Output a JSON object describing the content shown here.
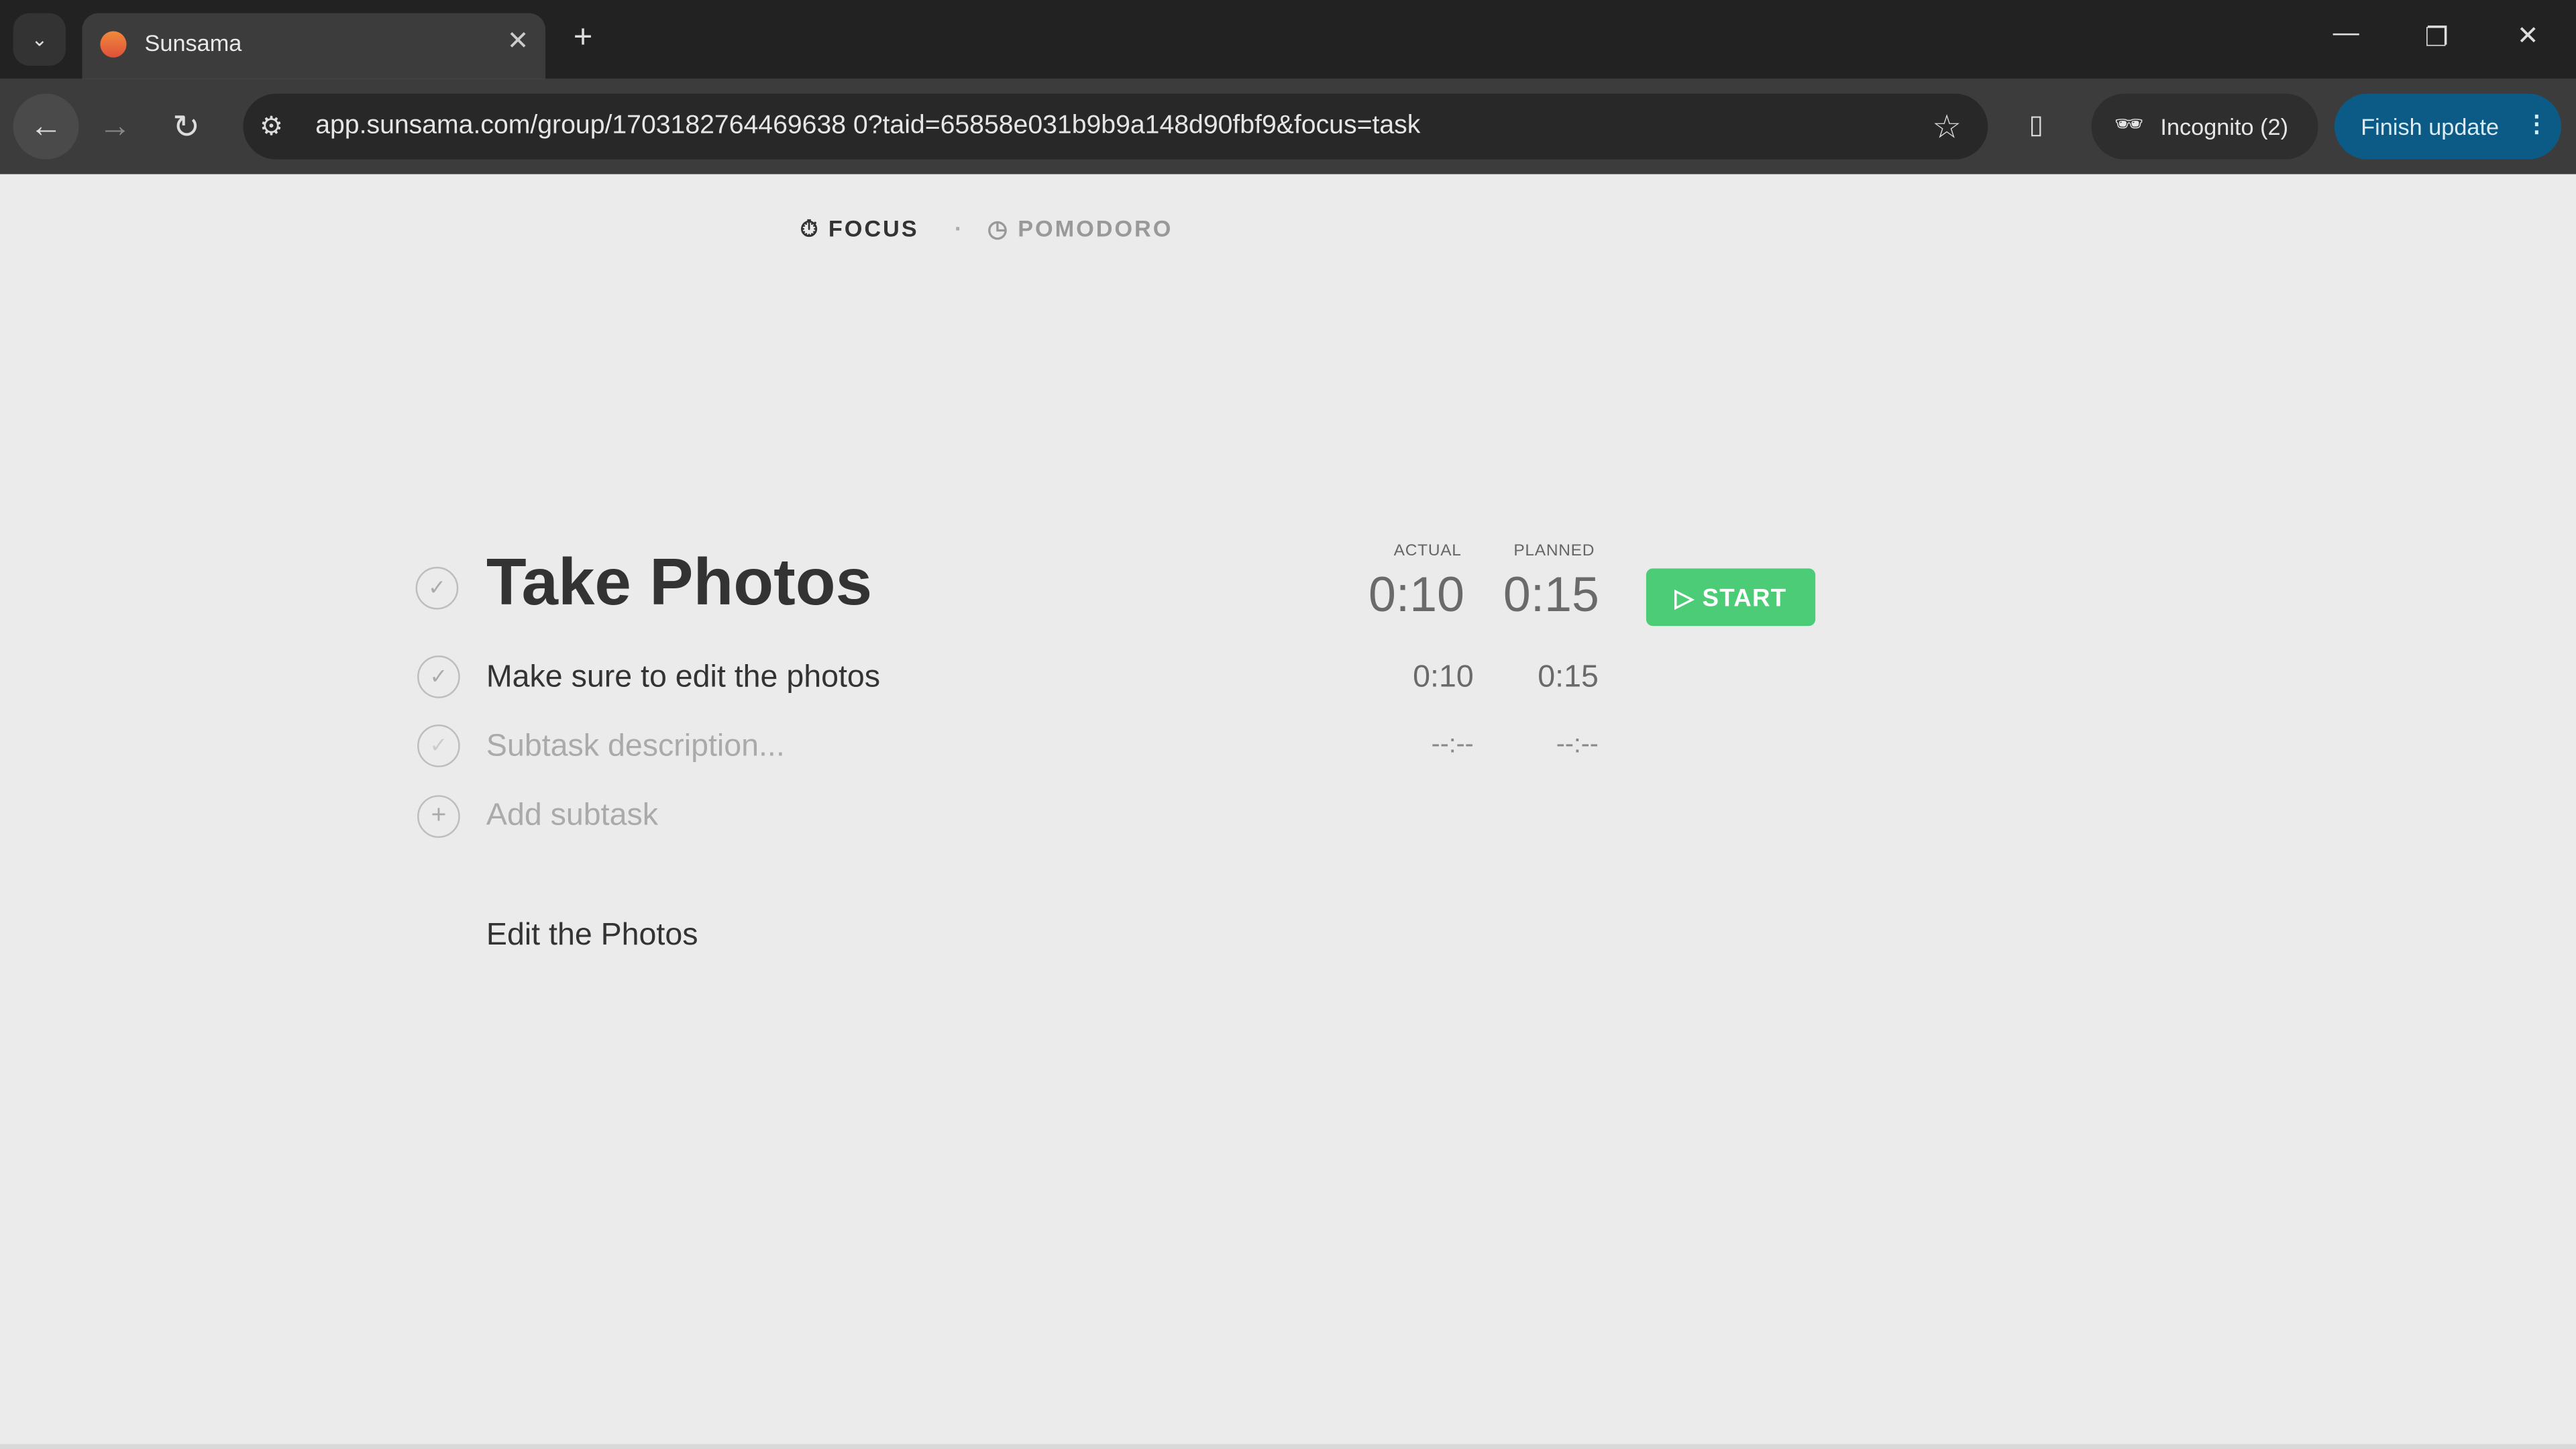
{
  "browser": {
    "tab_title": "Sunsama",
    "url": "app.sunsama.com/group/1703182764469638 0?taid=65858e031b9b9a148d90fbf9&focus=task",
    "profile": "Incognito (2)",
    "update_button": "Finish update"
  },
  "header": {
    "focus": "FOCUS",
    "separator": "·",
    "pomodoro": "POMODORO"
  },
  "task": {
    "title": "Take Photos",
    "actual_label": "ACTUAL",
    "planned_label": "PLANNED",
    "actual": "0:10",
    "planned": "0:15",
    "start_label": "START",
    "subtasks": [
      {
        "text": "Make sure to edit the photos",
        "actual": "0:10",
        "planned": "0:15"
      },
      {
        "placeholder": "Subtask description...",
        "actual": "--:--",
        "planned": "--:--"
      }
    ],
    "add_subtask": "Add subtask",
    "notes": "Edit the Photos"
  },
  "colors": {
    "accent_green": "#4ccc76",
    "update_blue": "#0b5b86",
    "page_bg": "#ebebeb"
  }
}
